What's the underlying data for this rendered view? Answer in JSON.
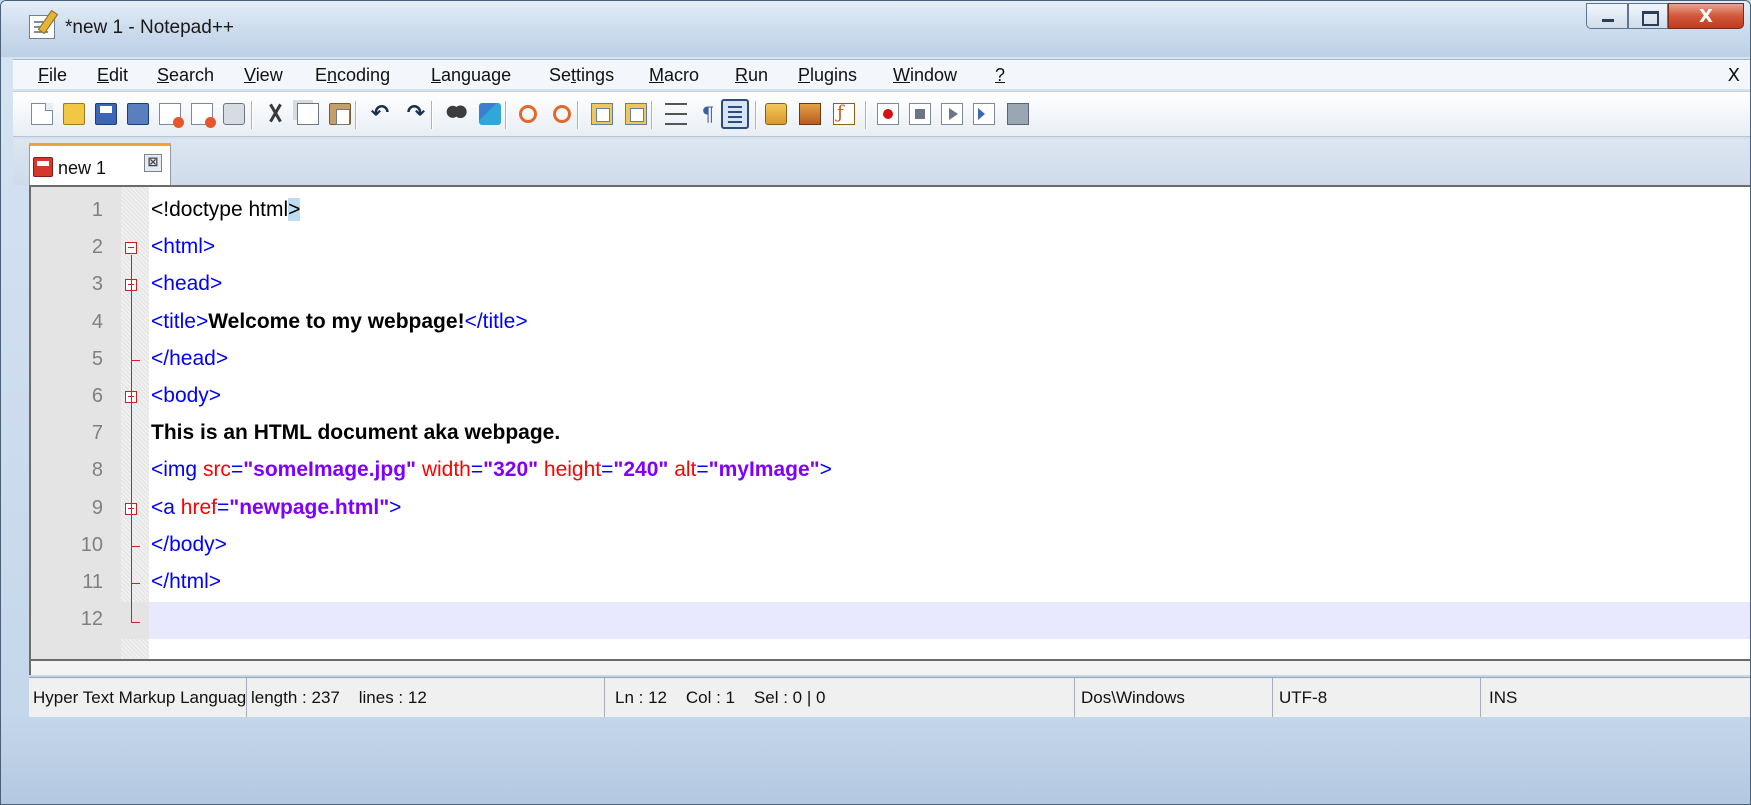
{
  "window": {
    "title": "*new 1 - Notepad++",
    "close_glyph": "X"
  },
  "menu": {
    "items": [
      {
        "pre": "",
        "u": "F",
        "post": "ile"
      },
      {
        "pre": "",
        "u": "E",
        "post": "dit"
      },
      {
        "pre": "",
        "u": "S",
        "post": "earch"
      },
      {
        "pre": "",
        "u": "V",
        "post": "iew"
      },
      {
        "pre": "E",
        "u": "n",
        "post": "coding"
      },
      {
        "pre": "",
        "u": "L",
        "post": "anguage"
      },
      {
        "pre": "Se",
        "u": "t",
        "post": "tings"
      },
      {
        "pre": "",
        "u": "M",
        "post": "acro"
      },
      {
        "pre": "",
        "u": "R",
        "post": "un"
      },
      {
        "pre": "",
        "u": "P",
        "post": "lugins"
      },
      {
        "pre": "",
        "u": "W",
        "post": "indow"
      },
      {
        "pre": "",
        "u": "?",
        "post": ""
      }
    ],
    "close_label": "X"
  },
  "toolbar": {
    "icons": [
      "new-file-icon",
      "open-file-icon",
      "save-icon",
      "save-all-icon",
      "close-icon",
      "close-all-icon",
      "print-icon",
      "cut-icon",
      "copy-icon",
      "paste-icon",
      "undo-icon",
      "redo-icon",
      "find-icon",
      "replace-icon",
      "zoom-in-icon",
      "zoom-out-icon",
      "sync-vertical-icon",
      "sync-horizontal-icon",
      "word-wrap-icon",
      "show-all-characters-icon",
      "indent-guide-icon",
      "user-language-icon",
      "document-map-icon",
      "function-list-icon",
      "record-macro-icon",
      "stop-recording-icon",
      "playback-macro-icon",
      "run-macro-multiple-icon",
      "save-macro-icon"
    ],
    "pilcrow": "¶",
    "undo_glyph": "↶",
    "redo_glyph": "↷"
  },
  "tabs": [
    {
      "label": "new 1",
      "close_glyph": "⊠"
    }
  ],
  "editor": {
    "current_line": 12,
    "lines": [
      {
        "n": "1",
        "tokens": [
          {
            "t": "<",
            "c": "doct"
          },
          {
            "t": "!doctype html",
            "c": "doct"
          },
          {
            "t": ">",
            "c": "doct hl"
          }
        ]
      },
      {
        "n": "2",
        "tokens": [
          {
            "t": "<html>",
            "c": "tag"
          }
        ]
      },
      {
        "n": "3",
        "tokens": [
          {
            "t": "<head>",
            "c": "tag"
          }
        ]
      },
      {
        "n": "4",
        "tokens": [
          {
            "t": "<title>",
            "c": "tag"
          },
          {
            "t": "Welcome to my webpage!",
            "c": "txt"
          },
          {
            "t": "</title>",
            "c": "tag"
          }
        ]
      },
      {
        "n": "5",
        "tokens": [
          {
            "t": "</head>",
            "c": "tag"
          }
        ]
      },
      {
        "n": "6",
        "tokens": [
          {
            "t": "<body>",
            "c": "tag"
          }
        ]
      },
      {
        "n": "7",
        "tokens": [
          {
            "t": "This is an HTML document aka webpage.",
            "c": "txt"
          }
        ]
      },
      {
        "n": "8",
        "tokens": [
          {
            "t": "<img ",
            "c": "tag"
          },
          {
            "t": "src",
            "c": "attr"
          },
          {
            "t": "=",
            "c": "tag"
          },
          {
            "t": "\"someImage.jpg\"",
            "c": "val"
          },
          {
            "t": " width",
            "c": "attr"
          },
          {
            "t": "=",
            "c": "tag"
          },
          {
            "t": "\"320\"",
            "c": "val"
          },
          {
            "t": " height",
            "c": "attr"
          },
          {
            "t": "=",
            "c": "tag"
          },
          {
            "t": "\"240\"",
            "c": "val"
          },
          {
            "t": " alt",
            "c": "attr"
          },
          {
            "t": "=",
            "c": "tag"
          },
          {
            "t": "\"myImage\"",
            "c": "val"
          },
          {
            "t": ">",
            "c": "tag"
          }
        ]
      },
      {
        "n": "9",
        "tokens": [
          {
            "t": "<a ",
            "c": "tag"
          },
          {
            "t": "href",
            "c": "attr"
          },
          {
            "t": "=",
            "c": "tag"
          },
          {
            "t": "\"newpage.html\"",
            "c": "val"
          },
          {
            "t": ">",
            "c": "tag"
          }
        ]
      },
      {
        "n": "10",
        "tokens": [
          {
            "t": "</body>",
            "c": "tag"
          }
        ]
      },
      {
        "n": "11",
        "tokens": [
          {
            "t": "</html>",
            "c": "tag"
          }
        ]
      },
      {
        "n": "12",
        "tokens": []
      }
    ],
    "colors": {
      "tag": "#0000ff",
      "attr": "#ff0000",
      "value": "#8000ff",
      "current_line_bg": "#e8e8ff",
      "fold_marker": "#d81b1b"
    }
  },
  "status": {
    "language": "Hyper Text Markup Language file",
    "length_lines": "length : 237    lines : 12",
    "position": "Ln : 12    Col : 1    Sel : 0 | 0",
    "eol": "Dos\\Windows",
    "encoding": "UTF-8",
    "mode": "INS"
  }
}
